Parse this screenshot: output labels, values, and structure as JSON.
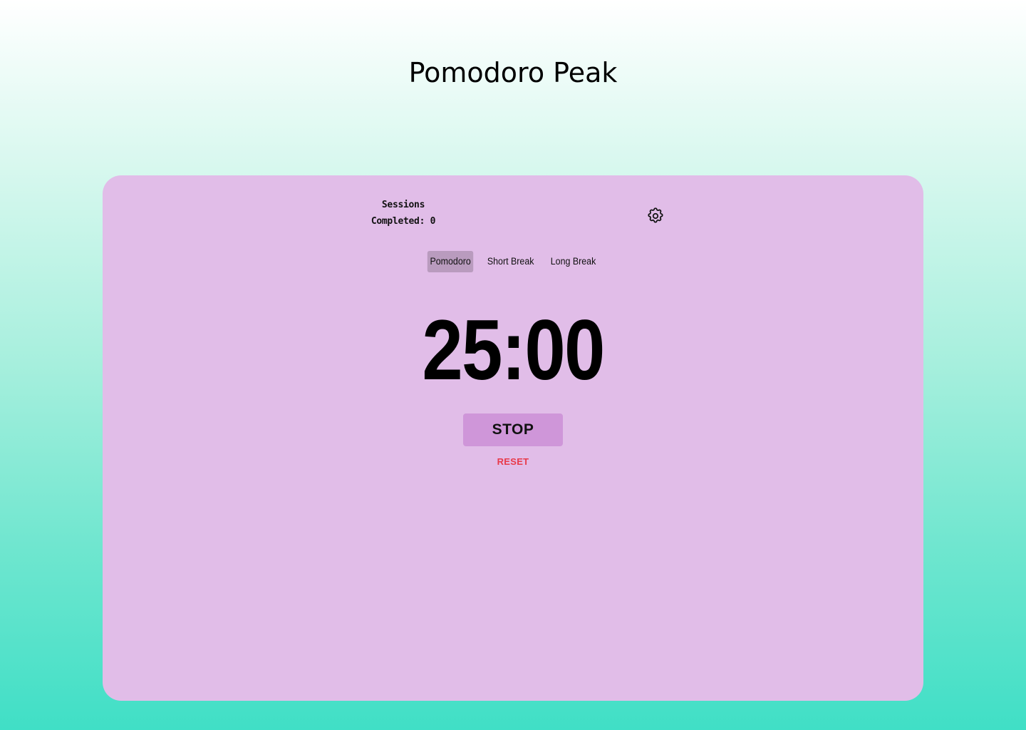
{
  "app": {
    "title": "Pomodoro Peak"
  },
  "sessions": {
    "line1": "Sessions",
    "line2": "Completed: 0"
  },
  "settings": {
    "icon": "gear-icon"
  },
  "modes": [
    {
      "label": "Pomodoro",
      "active": true
    },
    {
      "label": "Short Break",
      "active": false
    },
    {
      "label": "Long Break",
      "active": false
    }
  ],
  "timer": {
    "display": "25:00"
  },
  "controls": {
    "stop_label": "STOP",
    "reset_label": "RESET"
  },
  "colors": {
    "card_background": "#e1bde8",
    "active_tab": "#b99bbe",
    "stop_button": "#cf96d9",
    "reset_text": "#e83a4a",
    "gradient_bottom": "#40dfc6"
  }
}
